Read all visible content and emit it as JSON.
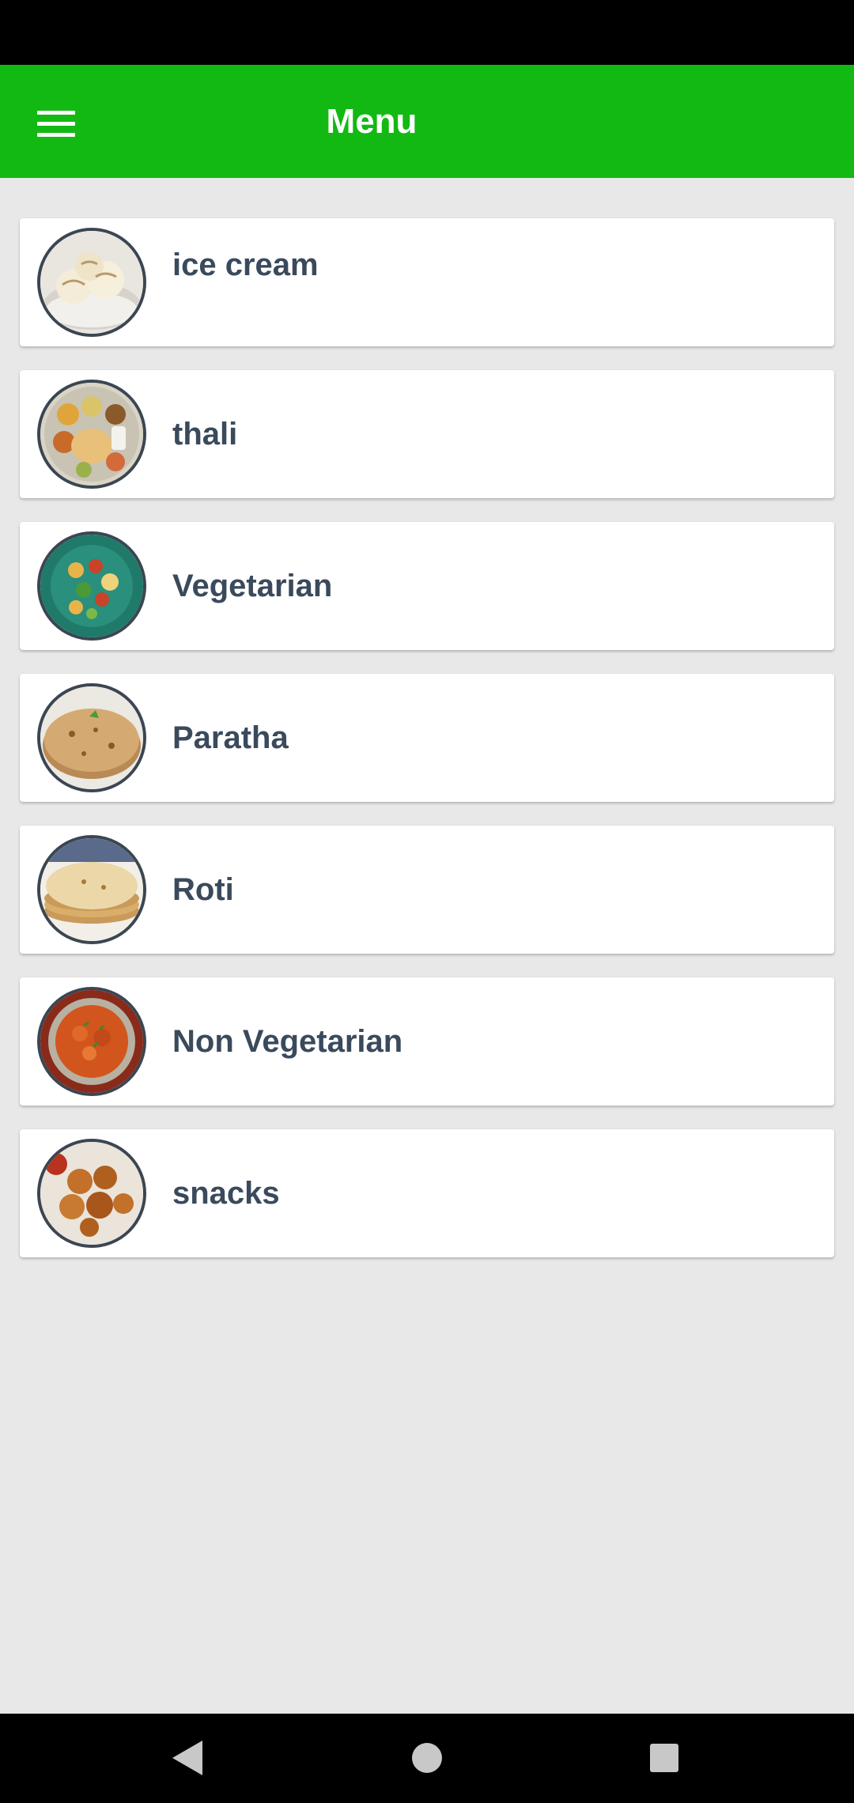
{
  "app_bar": {
    "title": "Menu",
    "menu_icon": "hamburger-icon"
  },
  "menu": {
    "items": [
      {
        "label": "ice cream",
        "image": "ice-cream-image"
      },
      {
        "label": "thali",
        "image": "thali-image"
      },
      {
        "label": "Vegetarian",
        "image": "vegetarian-image"
      },
      {
        "label": "Paratha",
        "image": "paratha-image"
      },
      {
        "label": "Roti",
        "image": "roti-image"
      },
      {
        "label": "Non Vegetarian",
        "image": "non-vegetarian-image"
      },
      {
        "label": "snacks",
        "image": "snacks-image"
      }
    ]
  },
  "nav_bar": {
    "back_icon": "back-icon",
    "home_icon": "home-icon",
    "recents_icon": "recents-icon"
  },
  "colors": {
    "app_bar": "#12b912",
    "background": "#e8e8e8",
    "label_text": "#3a4a5c",
    "thumb_border": "#3b4652"
  }
}
